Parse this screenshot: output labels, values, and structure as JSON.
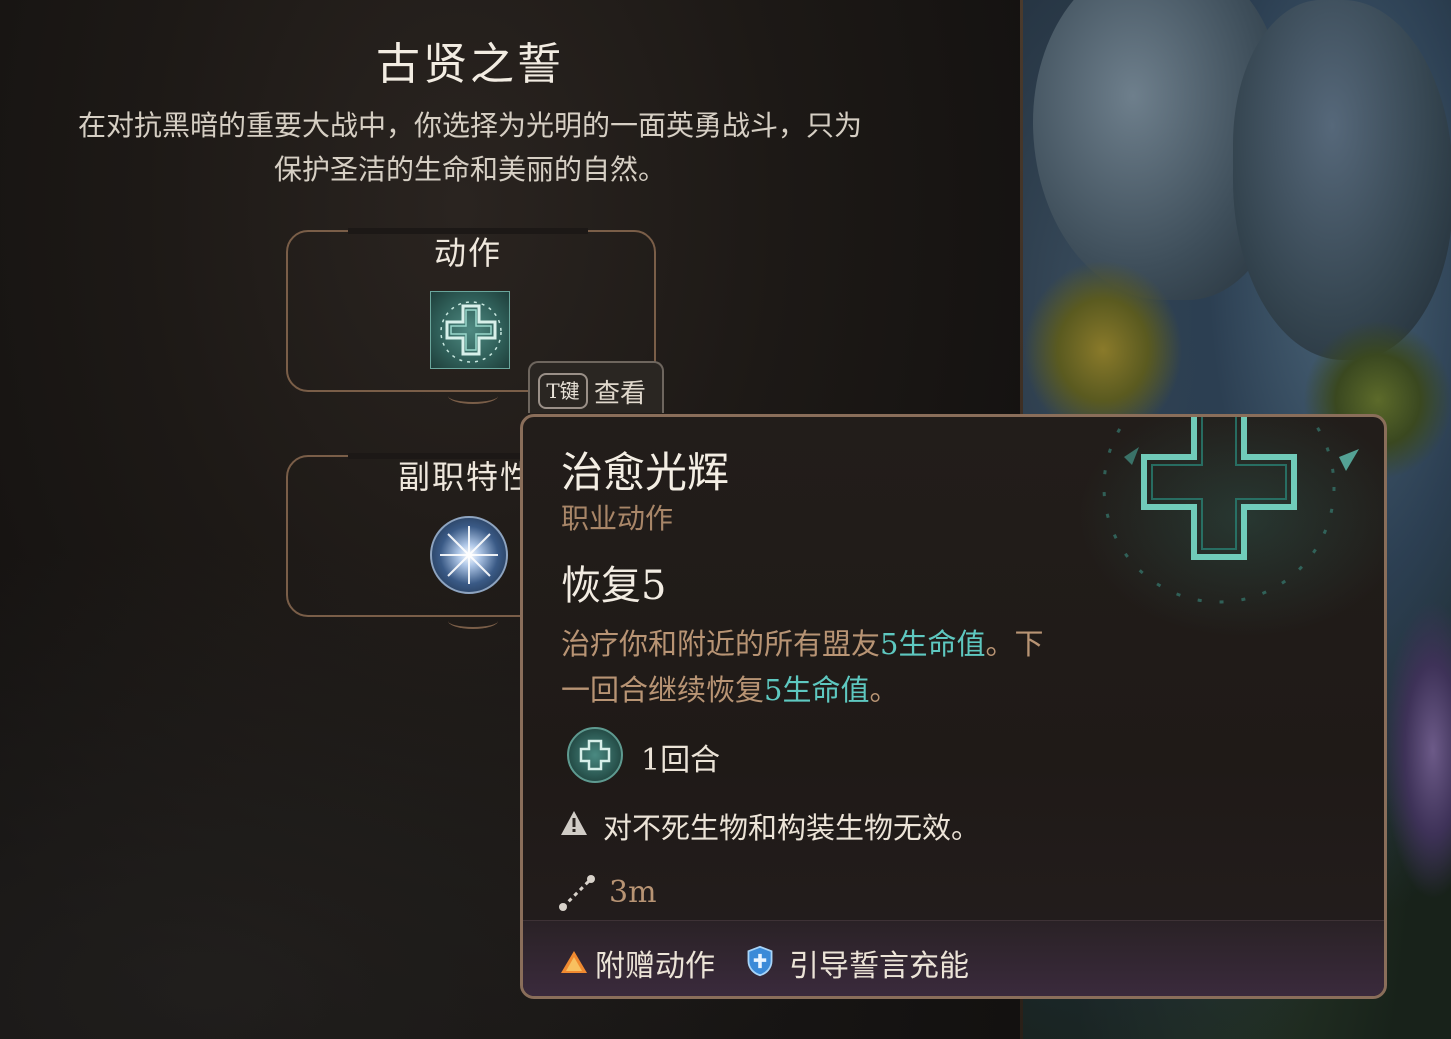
{
  "panel": {
    "title": "古贤之誓",
    "description_line1": "在对抗黑暗的重要大战中，你选择为光明的一面英勇战斗，只为",
    "description_line2": "保护圣洁的生命和美丽的自然。",
    "actions_label": "动作",
    "feats_label": "副职特性",
    "action_icon": "healing-radiance-icon",
    "feat_icon": "starburst-feat-icon"
  },
  "hint": {
    "key": "T键",
    "label": "查看"
  },
  "tooltip": {
    "name": "治愈光辉",
    "type": "职业动作",
    "heal_title": "恢复5",
    "desc_a": "治疗你和附近的所有盟友",
    "desc_b": "5生命值",
    "desc_c": "。下",
    "desc_d": "一回合继续恢复",
    "desc_e": "5生命值",
    "desc_f": "。",
    "duration": "1回合",
    "warning": "对不死生物和构装生物无效。",
    "range": "3m",
    "footer_cost": "附赠动作",
    "footer_resource": "引导誓言充能"
  },
  "colors": {
    "highlight": "#5ec8c0",
    "subtle": "#b89474",
    "border": "#8a6e5a"
  }
}
